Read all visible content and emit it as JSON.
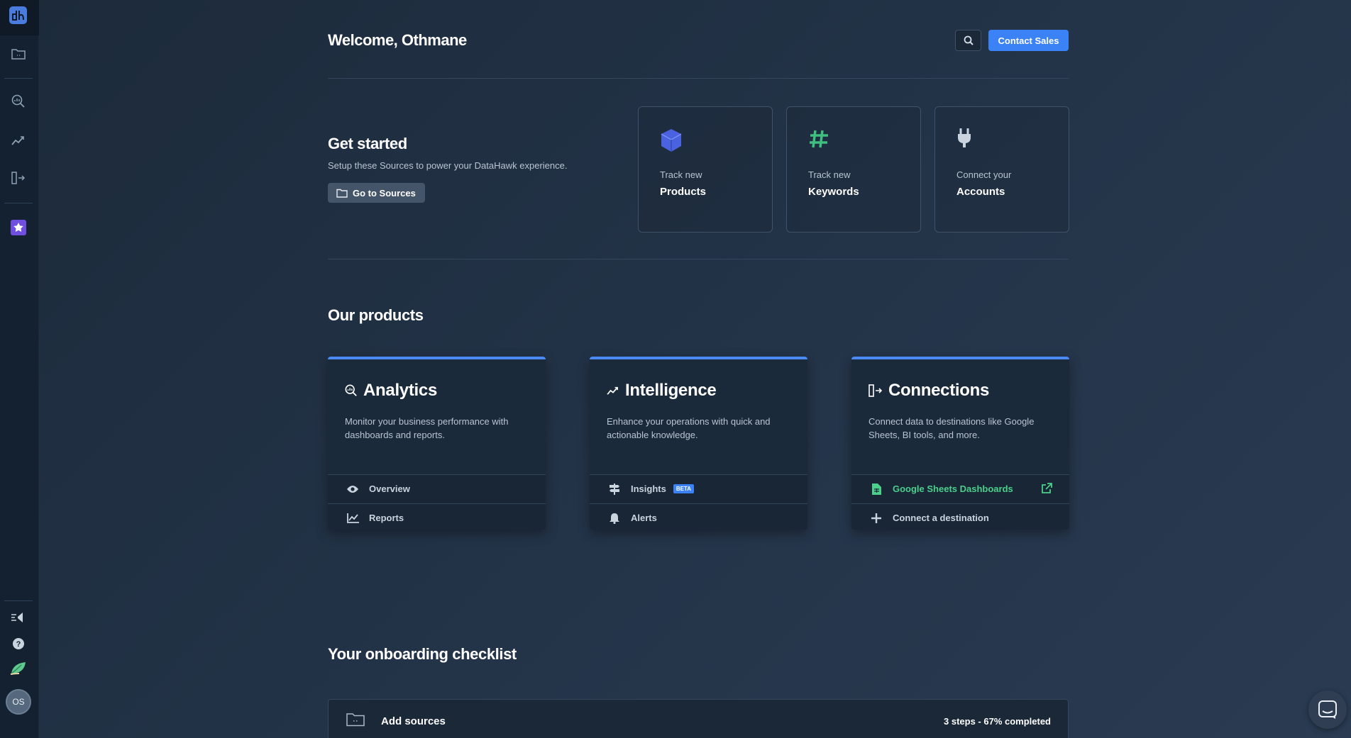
{
  "sidebar": {
    "avatar_initials": "OS"
  },
  "header": {
    "welcome": "Welcome, Othmane",
    "contact_label": "Contact Sales"
  },
  "get_started": {
    "title": "Get started",
    "subtitle": "Setup these Sources to power your DataHawk experience.",
    "button_label": "Go to Sources",
    "cards": [
      {
        "line1": "Track new",
        "line2": "Products",
        "icon": "cube-icon",
        "color": "#4a62e0"
      },
      {
        "line1": "Track new",
        "line2": "Keywords",
        "icon": "hashtag-icon",
        "color": "#3fbf7f"
      },
      {
        "line1": "Connect your",
        "line2": "Accounts",
        "icon": "plug-icon",
        "color": "#c9d4df"
      }
    ]
  },
  "products": {
    "title": "Our products",
    "items": [
      {
        "name": "Analytics",
        "description": "Monitor your business performance with dashboards and reports.",
        "links": [
          {
            "label": "Overview",
            "icon": "eye-icon"
          },
          {
            "label": "Reports",
            "icon": "line-chart-icon"
          }
        ]
      },
      {
        "name": "Intelligence",
        "description": "Enhance your operations with quick and actionable knowledge.",
        "links": [
          {
            "label": "Insights",
            "icon": "signpost-icon",
            "badge": "BETA"
          },
          {
            "label": "Alerts",
            "icon": "bell-icon"
          }
        ]
      },
      {
        "name": "Connections",
        "description": "Connect data to destinations like Google Sheets, BI tools, and more.",
        "links": [
          {
            "label": "Google Sheets Dashboards",
            "icon": "sheet-icon"
          },
          {
            "label": "Connect a destination",
            "icon": "plus-icon"
          }
        ]
      }
    ]
  },
  "checklist": {
    "title": "Your onboarding checklist",
    "item_label": "Add sources",
    "progress": "3 steps - 67% completed"
  },
  "colors": {
    "accent": "#3b82f6",
    "green": "#4ccf8b",
    "background": "#223246"
  }
}
